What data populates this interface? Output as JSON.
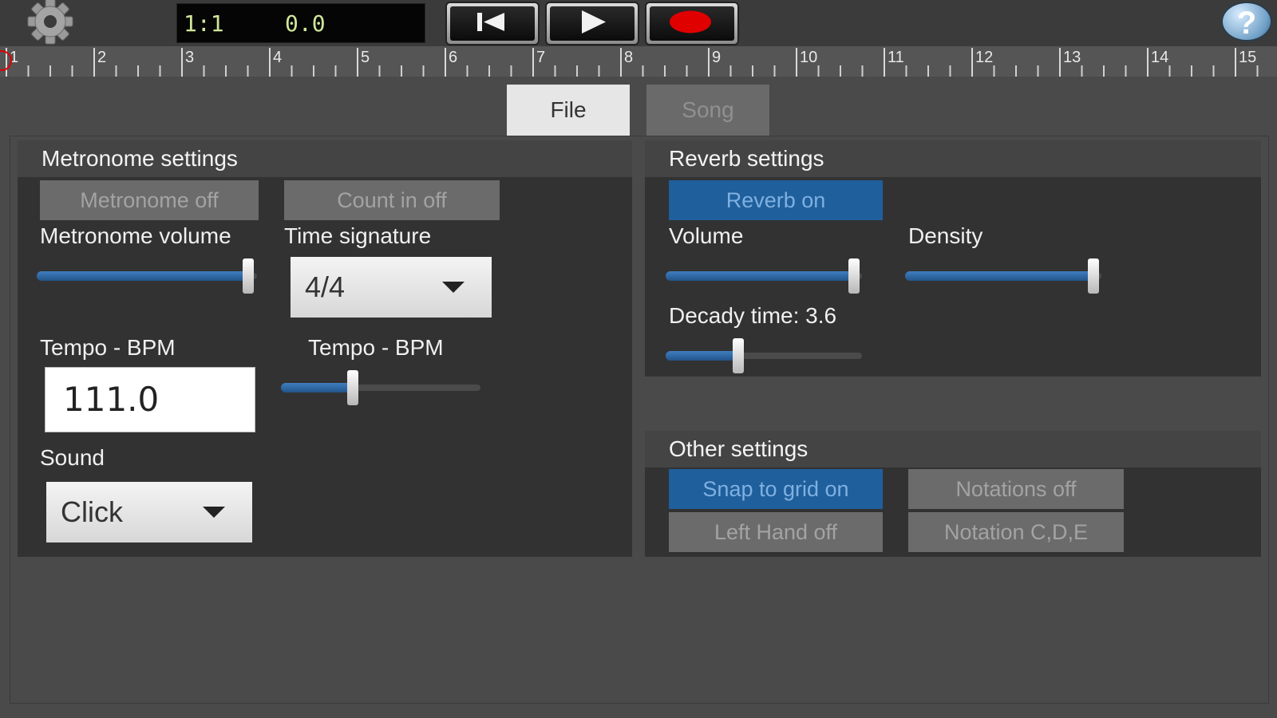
{
  "toolbar": {
    "counter_position": "1:1",
    "counter_time": "0.0"
  },
  "ruler": {
    "numbers": [
      "1",
      "2",
      "3",
      "4",
      "5",
      "6",
      "7",
      "8",
      "9",
      "10",
      "11",
      "12",
      "13",
      "14",
      "15"
    ]
  },
  "tabs": [
    {
      "label": "File",
      "active": true
    },
    {
      "label": "Song",
      "active": false
    }
  ],
  "metronome": {
    "header": "Metronome settings",
    "metronome_toggle": "Metronome off",
    "count_in_toggle": "Count in off",
    "volume_label": "Metronome volume",
    "volume_level": 0.96,
    "time_signature_label": "Time signature",
    "time_signature_value": "4/4",
    "tempo_label": "Tempo - BPM",
    "tempo_value": "111.0",
    "tempo_slider_label": "Tempo - BPM",
    "tempo_slider_level": 0.36,
    "sound_label": "Sound",
    "sound_value": "Click"
  },
  "reverb": {
    "header": "Reverb settings",
    "toggle": "Reverb on",
    "volume_label": "Volume",
    "volume_level": 0.96,
    "density_label": "Density",
    "density_level": 0.96,
    "decay_label": "Decady time: 3.6",
    "decay_level": 0.37
  },
  "other": {
    "header": "Other settings",
    "snap": "Snap to grid on",
    "notations": "Notations off",
    "left_hand": "Left Hand off",
    "notation_type": "Notation C,D,E"
  },
  "colors": {
    "accent": "#1f5f9c",
    "record": "#e00000",
    "counter_text": "#cfe69a"
  }
}
